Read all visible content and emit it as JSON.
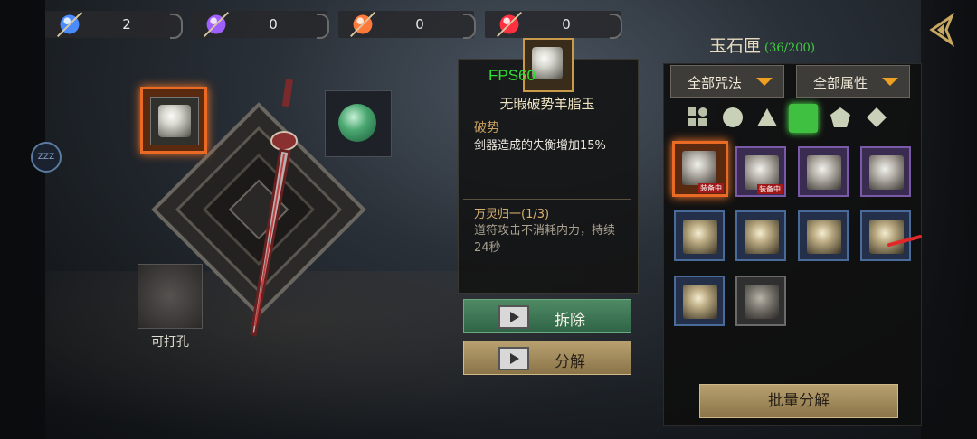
{
  "currencies": [
    {
      "name": "blue-crystal",
      "value": "2",
      "color": "#4a8cff"
    },
    {
      "name": "purple-crystal",
      "value": "0",
      "color": "#a060ff"
    },
    {
      "name": "orange-crystal",
      "value": "0",
      "color": "#ff7a3a"
    },
    {
      "name": "red-crystal",
      "value": "0",
      "color": "#ff3040"
    }
  ],
  "sleep_icon": "ZZZ",
  "equipment": {
    "socket_label": "可打孔"
  },
  "detail": {
    "fps": "FPS60",
    "gem_name": "无暇破势羊脂玉",
    "attr_title": "破势",
    "attr_desc": "剑器造成的失衡增加15%",
    "set_title": "万灵归一(1/3)",
    "set_desc": "道符攻击不消耗内力，持续24秒",
    "remove_label": "拆除",
    "break_label": "分解"
  },
  "inventory": {
    "title": "玉石匣",
    "count": "(36/200)",
    "filter_spell": "全部咒法",
    "filter_attr": "全部属性",
    "equipped_tag": "装备中",
    "bulk_break_label": "批量分解"
  },
  "colors": {
    "accent_orange": "#e86a24",
    "green_button": "#3f7a56",
    "gold_button": "#a88c5c",
    "count_green": "#40d040"
  }
}
